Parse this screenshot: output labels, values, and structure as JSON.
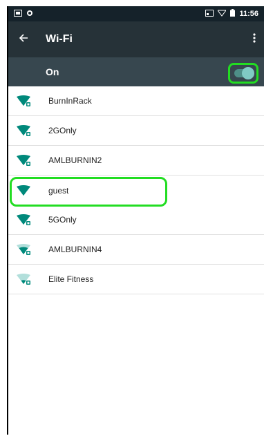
{
  "status": {
    "time": "11:56"
  },
  "appbar": {
    "title": "Wi-Fi"
  },
  "master": {
    "label": "On",
    "enabled": true
  },
  "networks": [
    {
      "name": "BurnInRack",
      "signal": "full",
      "secured": true
    },
    {
      "name": "2GOnly",
      "signal": "full",
      "secured": true
    },
    {
      "name": "AMLBURNIN2",
      "signal": "full",
      "secured": true
    },
    {
      "name": "guest",
      "signal": "full",
      "secured": false
    },
    {
      "name": "5GOnly",
      "signal": "full",
      "secured": true
    },
    {
      "name": "AMLBURNIN4",
      "signal": "medium",
      "secured": true
    },
    {
      "name": "Elite Fitness",
      "signal": "weak",
      "secured": true
    }
  ],
  "colors": {
    "accent": "#00897b",
    "highlight": "#22dd22",
    "appbar": "#263238",
    "master": "#37474f"
  }
}
